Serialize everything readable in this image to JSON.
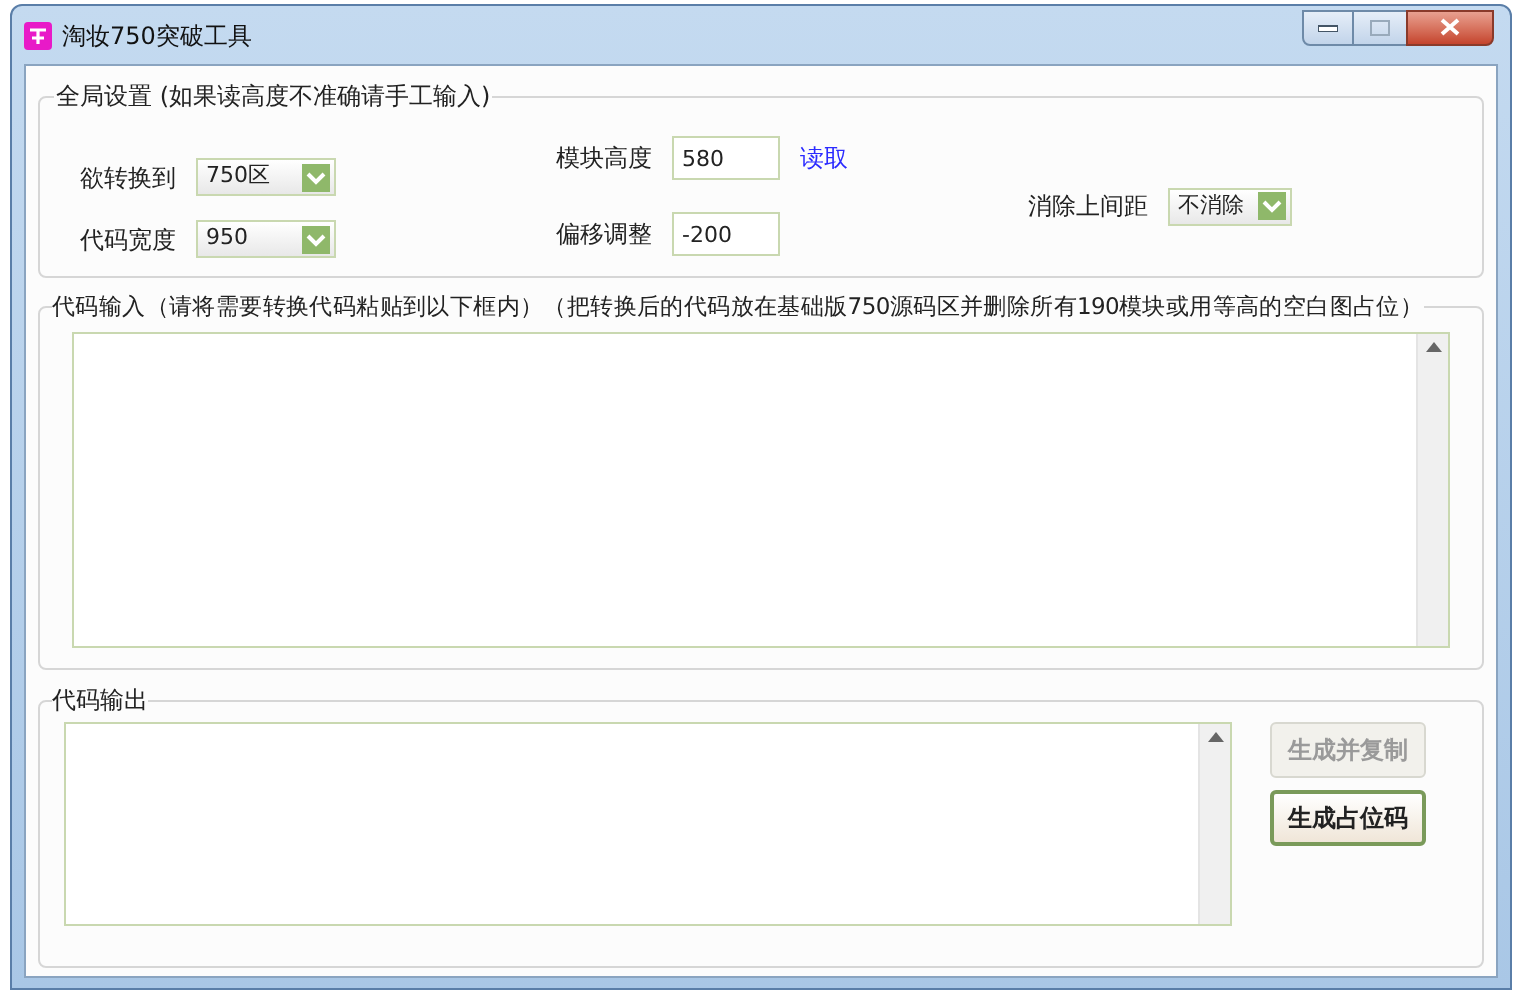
{
  "window": {
    "title": "淘妆750突破工具"
  },
  "global_settings": {
    "legend": "全局设置 (如果读高度不准确请手工输入)",
    "convert_to": {
      "label": "欲转换到",
      "value": "750区"
    },
    "code_width": {
      "label": "代码宽度",
      "value": "950"
    },
    "module_height": {
      "label": "模块高度",
      "value": "580"
    },
    "read_link": "读取",
    "offset": {
      "label": "偏移调整",
      "value": "-200"
    },
    "remove_top_margin": {
      "label": "消除上间距",
      "value": "不消除"
    }
  },
  "code_input": {
    "legend": "代码输入（请将需要转换代码粘贴到以下框内）（把转换后的代码放在基础版750源码区并删除所有190模块或用等高的空白图占位）"
  },
  "code_output": {
    "legend": "代码输出"
  },
  "buttons": [
    {
      "label": "生成并复制",
      "disabled": true
    },
    {
      "label": "生成占位码",
      "disabled": false
    }
  ]
}
